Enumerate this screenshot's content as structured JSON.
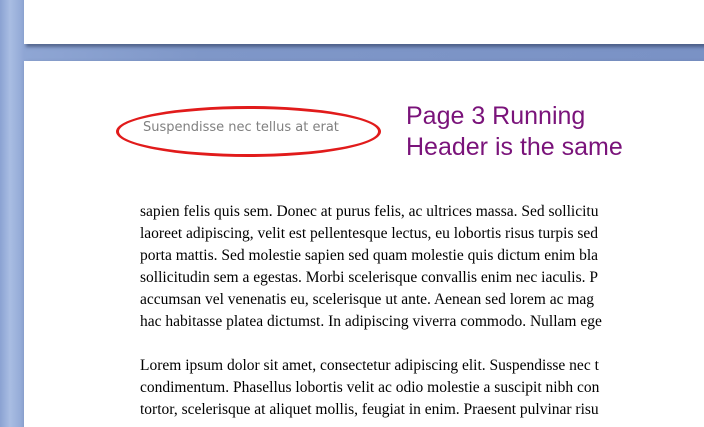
{
  "document": {
    "running_header": "Suspendisse nec tellus at erat",
    "annotation": {
      "line1": "Page 3 Running",
      "line2": "Header is the same",
      "color": "#7a137a"
    },
    "highlight_color": "#e11b1b",
    "paragraphs": [
      {
        "lines": [
          "sapien felis quis sem. Donec at purus felis, ac ultrices massa. Sed sollicitu",
          "laoreet adipiscing, velit est pellentesque lectus, eu lobortis risus turpis sed",
          "porta mattis. Sed molestie sapien sed quam molestie quis dictum enim bla",
          "sollicitudin sem a egestas. Morbi scelerisque convallis enim nec iaculis. P",
          "accumsan vel venenatis eu, scelerisque ut ante. Aenean sed lorem ac mag",
          "hac habitasse platea dictumst. In adipiscing viverra commodo. Nullam ege"
        ]
      },
      {
        "lines": [
          "Lorem ipsum dolor sit amet, consectetur adipiscing elit.  Suspendisse nec t",
          "condimentum. Phasellus lobortis velit ac odio molestie a suscipit nibh con",
          "tortor, scelerisque at aliquet mollis, feugiat in enim. Praesent pulvinar risu"
        ]
      }
    ]
  }
}
